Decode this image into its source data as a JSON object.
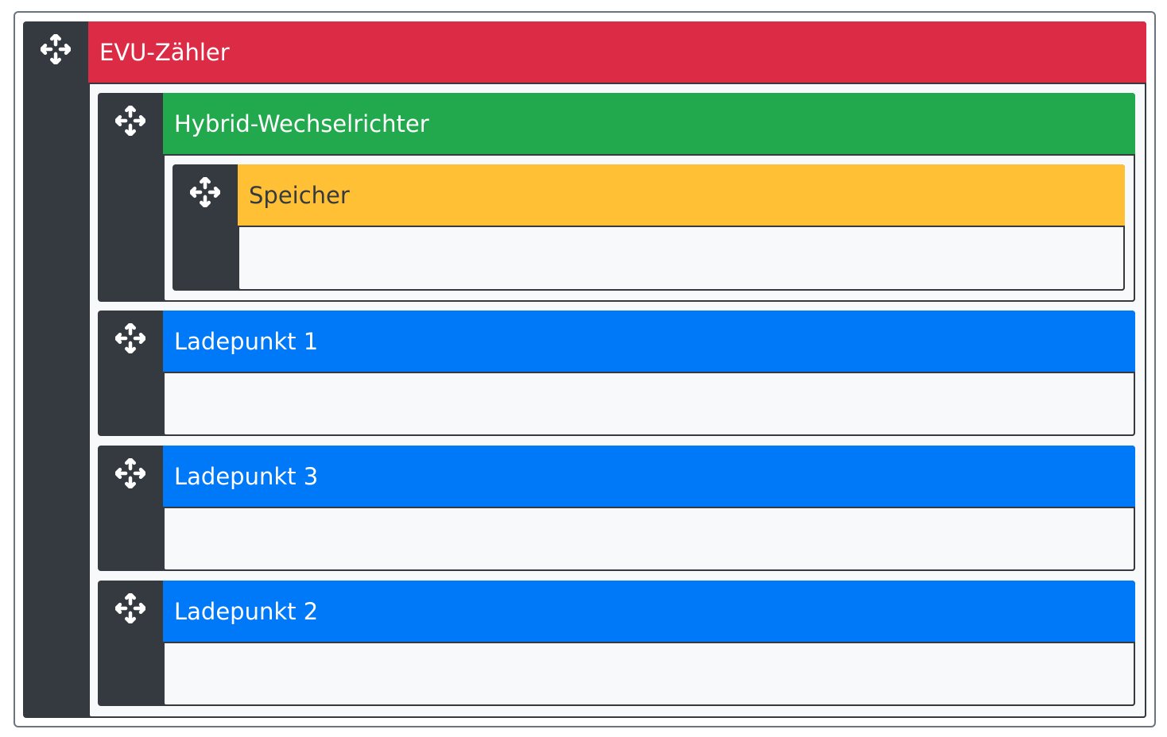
{
  "colors": {
    "dark": "#343a40",
    "evu": "#dc2b45",
    "inverter": "#23a94d",
    "battery": "#ffc035",
    "chargepoint": "#0079f8",
    "body_bg": "#f8f9fa"
  },
  "icons": {
    "handle": "arrows-move-icon"
  },
  "hierarchy": {
    "root": {
      "label": "EVU-Zähler",
      "children": [
        {
          "label": "Hybrid-Wechselrichter",
          "children": [
            {
              "label": "Speicher"
            }
          ]
        },
        {
          "label": "Ladepunkt 1"
        },
        {
          "label": "Ladepunkt 3"
        },
        {
          "label": "Ladepunkt 2"
        }
      ]
    }
  }
}
